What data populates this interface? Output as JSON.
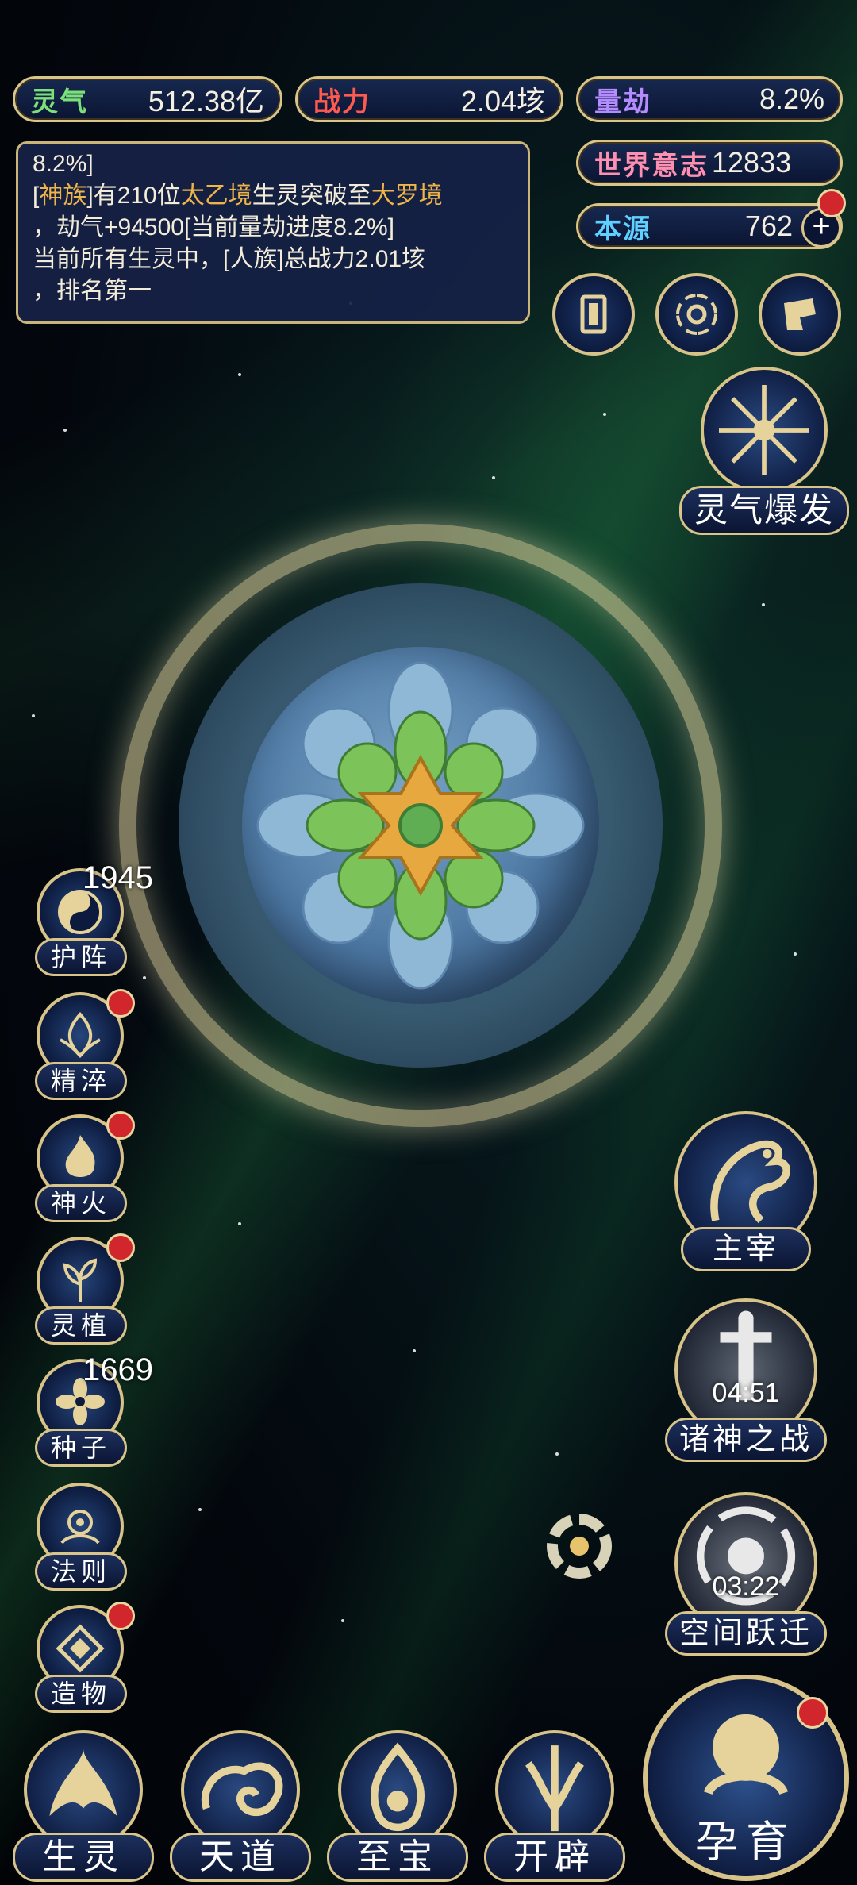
{
  "resources": {
    "lingqi": {
      "label": "灵气",
      "value": "512.38亿"
    },
    "zhanli": {
      "label": "战力",
      "value": "2.04垓"
    },
    "liangjie": {
      "label": "量劫",
      "value": "8.2%"
    },
    "shijie": {
      "label": "世界意志",
      "value": "12833"
    },
    "benyuan": {
      "label": "本源",
      "value": "762"
    }
  },
  "log": {
    "line1": "8.2%]",
    "line2_a": "[",
    "line2_b": "神族",
    "line2_c": "]有210位",
    "line2_d": "太乙境",
    "line2_e": "生灵突破至",
    "line2_f": "大罗境",
    "line3": "，劫气+94500[当前量劫进度8.2%]",
    "line4": "当前所有生灵中，[人族]总战力2.01垓",
    "line5": "，排名第一"
  },
  "burst": {
    "label": "灵气爆发"
  },
  "side_menu": [
    {
      "label": "护阵",
      "count": "1945"
    },
    {
      "label": "精淬"
    },
    {
      "label": "神火"
    },
    {
      "label": "灵植"
    },
    {
      "label": "种子",
      "count": "1669"
    },
    {
      "label": "法则"
    },
    {
      "label": "造物"
    }
  ],
  "right_menu": {
    "zhuzai": {
      "label": "主宰"
    },
    "zhushen": {
      "label": "诸神之战",
      "timer": "04:51"
    },
    "kongjian": {
      "label": "空间跃迁",
      "timer": "03:22"
    }
  },
  "bottom_nav": [
    {
      "label": "生灵"
    },
    {
      "label": "天道"
    },
    {
      "label": "至宝"
    },
    {
      "label": "开辟"
    }
  ],
  "main_button": {
    "label": "孕育"
  },
  "colors": {
    "gold": "#d9c48a",
    "highlight": "#f0b54a",
    "badge": "#d0262c",
    "panel": "#17284f"
  }
}
